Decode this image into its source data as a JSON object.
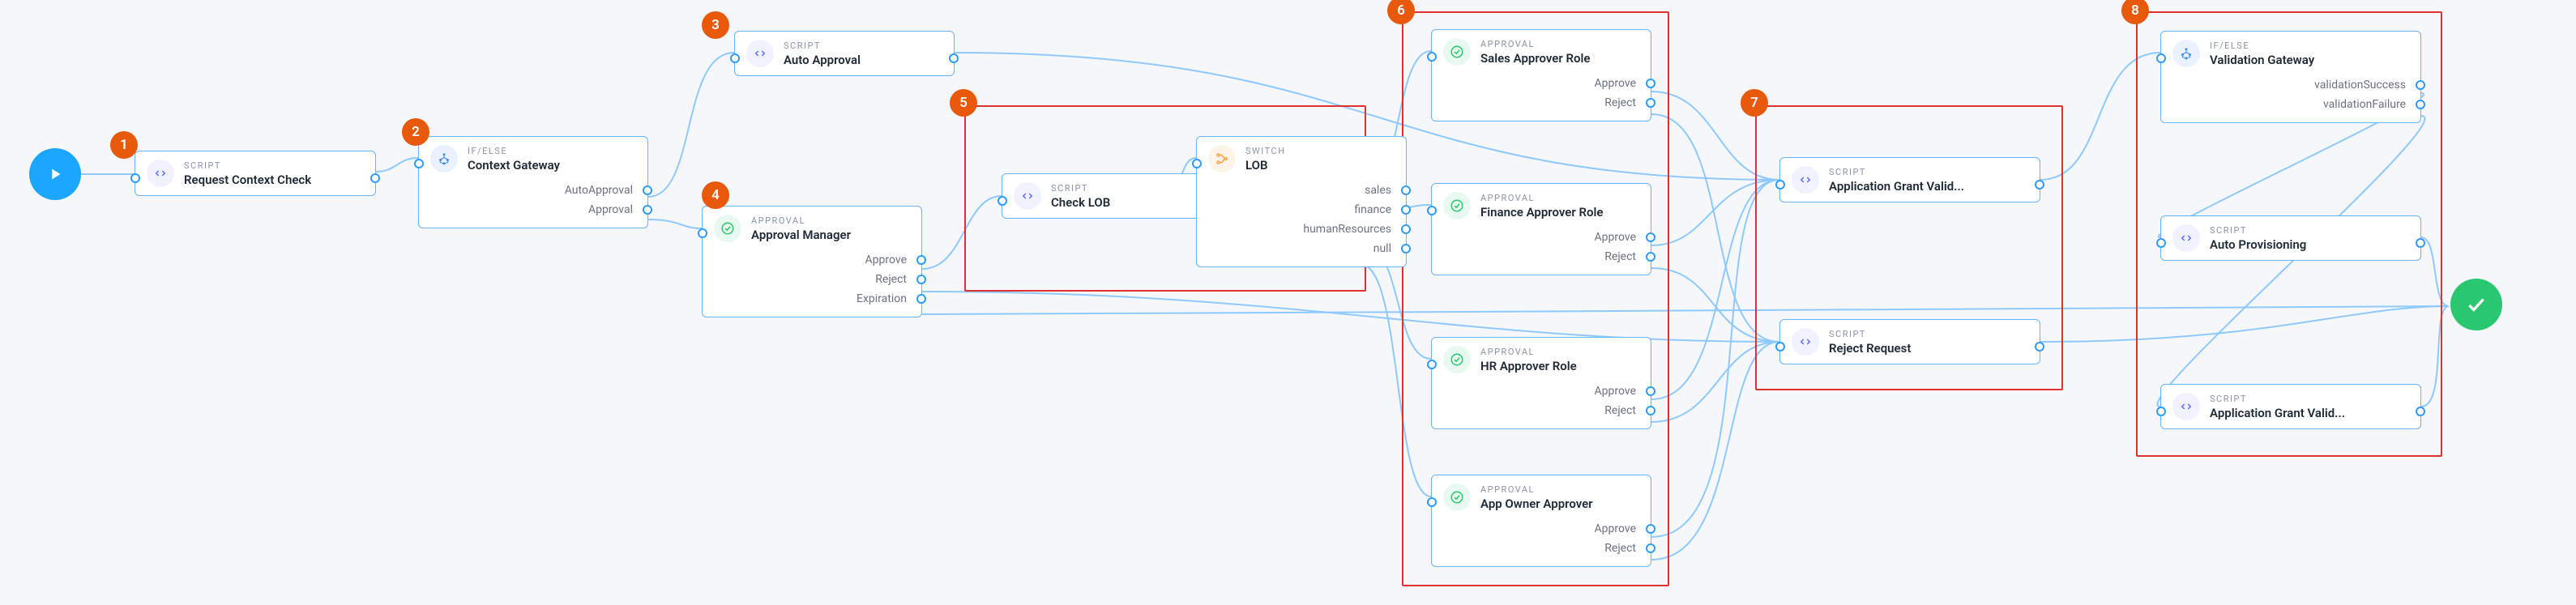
{
  "nodes": {
    "requestContextCheck": {
      "type": "SCRIPT",
      "title": "Request Context Check"
    },
    "contextGateway": {
      "type": "IF/ELSE",
      "title": "Context Gateway",
      "outputs": [
        "AutoApproval",
        "Approval"
      ]
    },
    "autoApproval": {
      "type": "SCRIPT",
      "title": "Auto Approval"
    },
    "approvalManager": {
      "type": "APPROVAL",
      "title": "Approval Manager",
      "outputs": [
        "Approve",
        "Reject",
        "Expiration"
      ]
    },
    "checkLOB": {
      "type": "SCRIPT",
      "title": "Check LOB"
    },
    "lobSwitch": {
      "type": "SWITCH",
      "title": "LOB",
      "outputs": [
        "sales",
        "finance",
        "humanResources",
        "null"
      ]
    },
    "salesApprover": {
      "type": "APPROVAL",
      "title": "Sales Approver Role",
      "outputs": [
        "Approve",
        "Reject"
      ]
    },
    "financeApprover": {
      "type": "APPROVAL",
      "title": "Finance Approver Role",
      "outputs": [
        "Approve",
        "Reject"
      ]
    },
    "hrApprover": {
      "type": "APPROVAL",
      "title": "HR Approver Role",
      "outputs": [
        "Approve",
        "Reject"
      ]
    },
    "appOwnerApprover": {
      "type": "APPROVAL",
      "title": "App Owner Approver",
      "outputs": [
        "Approve",
        "Reject"
      ]
    },
    "appGrantValid1": {
      "type": "SCRIPT",
      "title": "Application Grant Valid..."
    },
    "rejectRequest": {
      "type": "SCRIPT",
      "title": "Reject Request"
    },
    "validationGateway": {
      "type": "IF/ELSE",
      "title": "Validation Gateway",
      "outputs": [
        "validationSuccess",
        "validationFailure"
      ]
    },
    "autoProvisioning": {
      "type": "SCRIPT",
      "title": "Auto Provisioning"
    },
    "appGrantValid2": {
      "type": "SCRIPT",
      "title": "Application Grant Valid..."
    }
  },
  "badges": {
    "b1": "1",
    "b2": "2",
    "b3": "3",
    "b4": "4",
    "b5": "5",
    "b6": "6",
    "b7": "7",
    "b8": "8"
  },
  "chart_data": {
    "type": "table",
    "title": "Workflow graph nodes and edges",
    "nodes": [
      {
        "id": "start",
        "type": "Start",
        "label": ""
      },
      {
        "id": "requestContextCheck",
        "type": "SCRIPT",
        "label": "Request Context Check"
      },
      {
        "id": "contextGateway",
        "type": "IF/ELSE",
        "label": "Context Gateway",
        "outputs": [
          "AutoApproval",
          "Approval"
        ]
      },
      {
        "id": "autoApproval",
        "type": "SCRIPT",
        "label": "Auto Approval"
      },
      {
        "id": "approvalManager",
        "type": "APPROVAL",
        "label": "Approval Manager",
        "outputs": [
          "Approve",
          "Reject",
          "Expiration"
        ]
      },
      {
        "id": "checkLOB",
        "type": "SCRIPT",
        "label": "Check LOB"
      },
      {
        "id": "lobSwitch",
        "type": "SWITCH",
        "label": "LOB",
        "outputs": [
          "sales",
          "finance",
          "humanResources",
          "null"
        ]
      },
      {
        "id": "salesApprover",
        "type": "APPROVAL",
        "label": "Sales Approver Role",
        "outputs": [
          "Approve",
          "Reject"
        ]
      },
      {
        "id": "financeApprover",
        "type": "APPROVAL",
        "label": "Finance Approver Role",
        "outputs": [
          "Approve",
          "Reject"
        ]
      },
      {
        "id": "hrApprover",
        "type": "APPROVAL",
        "label": "HR Approver Role",
        "outputs": [
          "Approve",
          "Reject"
        ]
      },
      {
        "id": "appOwnerApprover",
        "type": "APPROVAL",
        "label": "App Owner Approver",
        "outputs": [
          "Approve",
          "Reject"
        ]
      },
      {
        "id": "appGrantValid1",
        "type": "SCRIPT",
        "label": "Application Grant Valid..."
      },
      {
        "id": "rejectRequest",
        "type": "SCRIPT",
        "label": "Reject Request"
      },
      {
        "id": "validationGateway",
        "type": "IF/ELSE",
        "label": "Validation Gateway",
        "outputs": [
          "validationSuccess",
          "validationFailure"
        ]
      },
      {
        "id": "autoProvisioning",
        "type": "SCRIPT",
        "label": "Auto Provisioning"
      },
      {
        "id": "appGrantValid2",
        "type": "SCRIPT",
        "label": "Application Grant Valid..."
      },
      {
        "id": "end",
        "type": "End",
        "label": ""
      }
    ],
    "edges": [
      {
        "from": "start",
        "to": "requestContextCheck"
      },
      {
        "from": "requestContextCheck",
        "to": "contextGateway"
      },
      {
        "from": "contextGateway",
        "via": "AutoApproval",
        "to": "autoApproval"
      },
      {
        "from": "contextGateway",
        "via": "Approval",
        "to": "approvalManager"
      },
      {
        "from": "autoApproval",
        "to": "appGrantValid1"
      },
      {
        "from": "approvalManager",
        "via": "Approve",
        "to": "checkLOB"
      },
      {
        "from": "approvalManager",
        "via": "Reject",
        "to": "rejectRequest"
      },
      {
        "from": "approvalManager",
        "via": "Expiration",
        "to": "end"
      },
      {
        "from": "checkLOB",
        "to": "lobSwitch"
      },
      {
        "from": "lobSwitch",
        "via": "sales",
        "to": "salesApprover"
      },
      {
        "from": "lobSwitch",
        "via": "finance",
        "to": "financeApprover"
      },
      {
        "from": "lobSwitch",
        "via": "humanResources",
        "to": "hrApprover"
      },
      {
        "from": "lobSwitch",
        "via": "null",
        "to": "appOwnerApprover"
      },
      {
        "from": "salesApprover",
        "via": "Approve",
        "to": "appGrantValid1"
      },
      {
        "from": "salesApprover",
        "via": "Reject",
        "to": "rejectRequest"
      },
      {
        "from": "financeApprover",
        "via": "Approve",
        "to": "appGrantValid1"
      },
      {
        "from": "financeApprover",
        "via": "Reject",
        "to": "rejectRequest"
      },
      {
        "from": "hrApprover",
        "via": "Approve",
        "to": "appGrantValid1"
      },
      {
        "from": "hrApprover",
        "via": "Reject",
        "to": "rejectRequest"
      },
      {
        "from": "appOwnerApprover",
        "via": "Approve",
        "to": "appGrantValid1"
      },
      {
        "from": "appOwnerApprover",
        "via": "Reject",
        "to": "rejectRequest"
      },
      {
        "from": "appGrantValid1",
        "to": "validationGateway"
      },
      {
        "from": "rejectRequest",
        "to": "end"
      },
      {
        "from": "validationGateway",
        "via": "validationSuccess",
        "to": "autoProvisioning"
      },
      {
        "from": "validationGateway",
        "via": "validationFailure",
        "to": "appGrantValid2"
      },
      {
        "from": "autoProvisioning",
        "to": "end"
      },
      {
        "from": "appGrantValid2",
        "to": "end"
      }
    ],
    "badge_map": {
      "1": "requestContextCheck",
      "2": "contextGateway",
      "3": "autoApproval",
      "4": "approvalManager",
      "5": [
        "checkLOB",
        "lobSwitch"
      ],
      "6": [
        "salesApprover",
        "financeApprover",
        "hrApprover",
        "appOwnerApprover"
      ],
      "7": [
        "appGrantValid1",
        "rejectRequest"
      ],
      "8": [
        "validationGateway",
        "autoProvisioning",
        "appGrantValid2"
      ]
    }
  }
}
